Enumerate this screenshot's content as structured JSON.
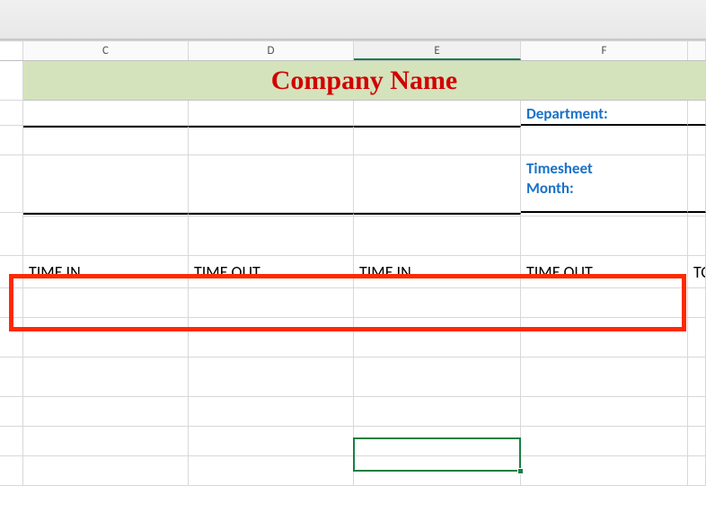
{
  "columns": {
    "C": "C",
    "D": "D",
    "E": "E",
    "F": "F"
  },
  "title": "Company Name",
  "labels": {
    "department": "Department:",
    "timesheet_month": "Timesheet\nMonth:"
  },
  "tableHeaders": {
    "c": "TIME IN",
    "d": "TIME OUT",
    "e": "TIME IN",
    "f": "TIME OUT",
    "g": "TO"
  },
  "activeColumn": "E",
  "chart_data": null
}
